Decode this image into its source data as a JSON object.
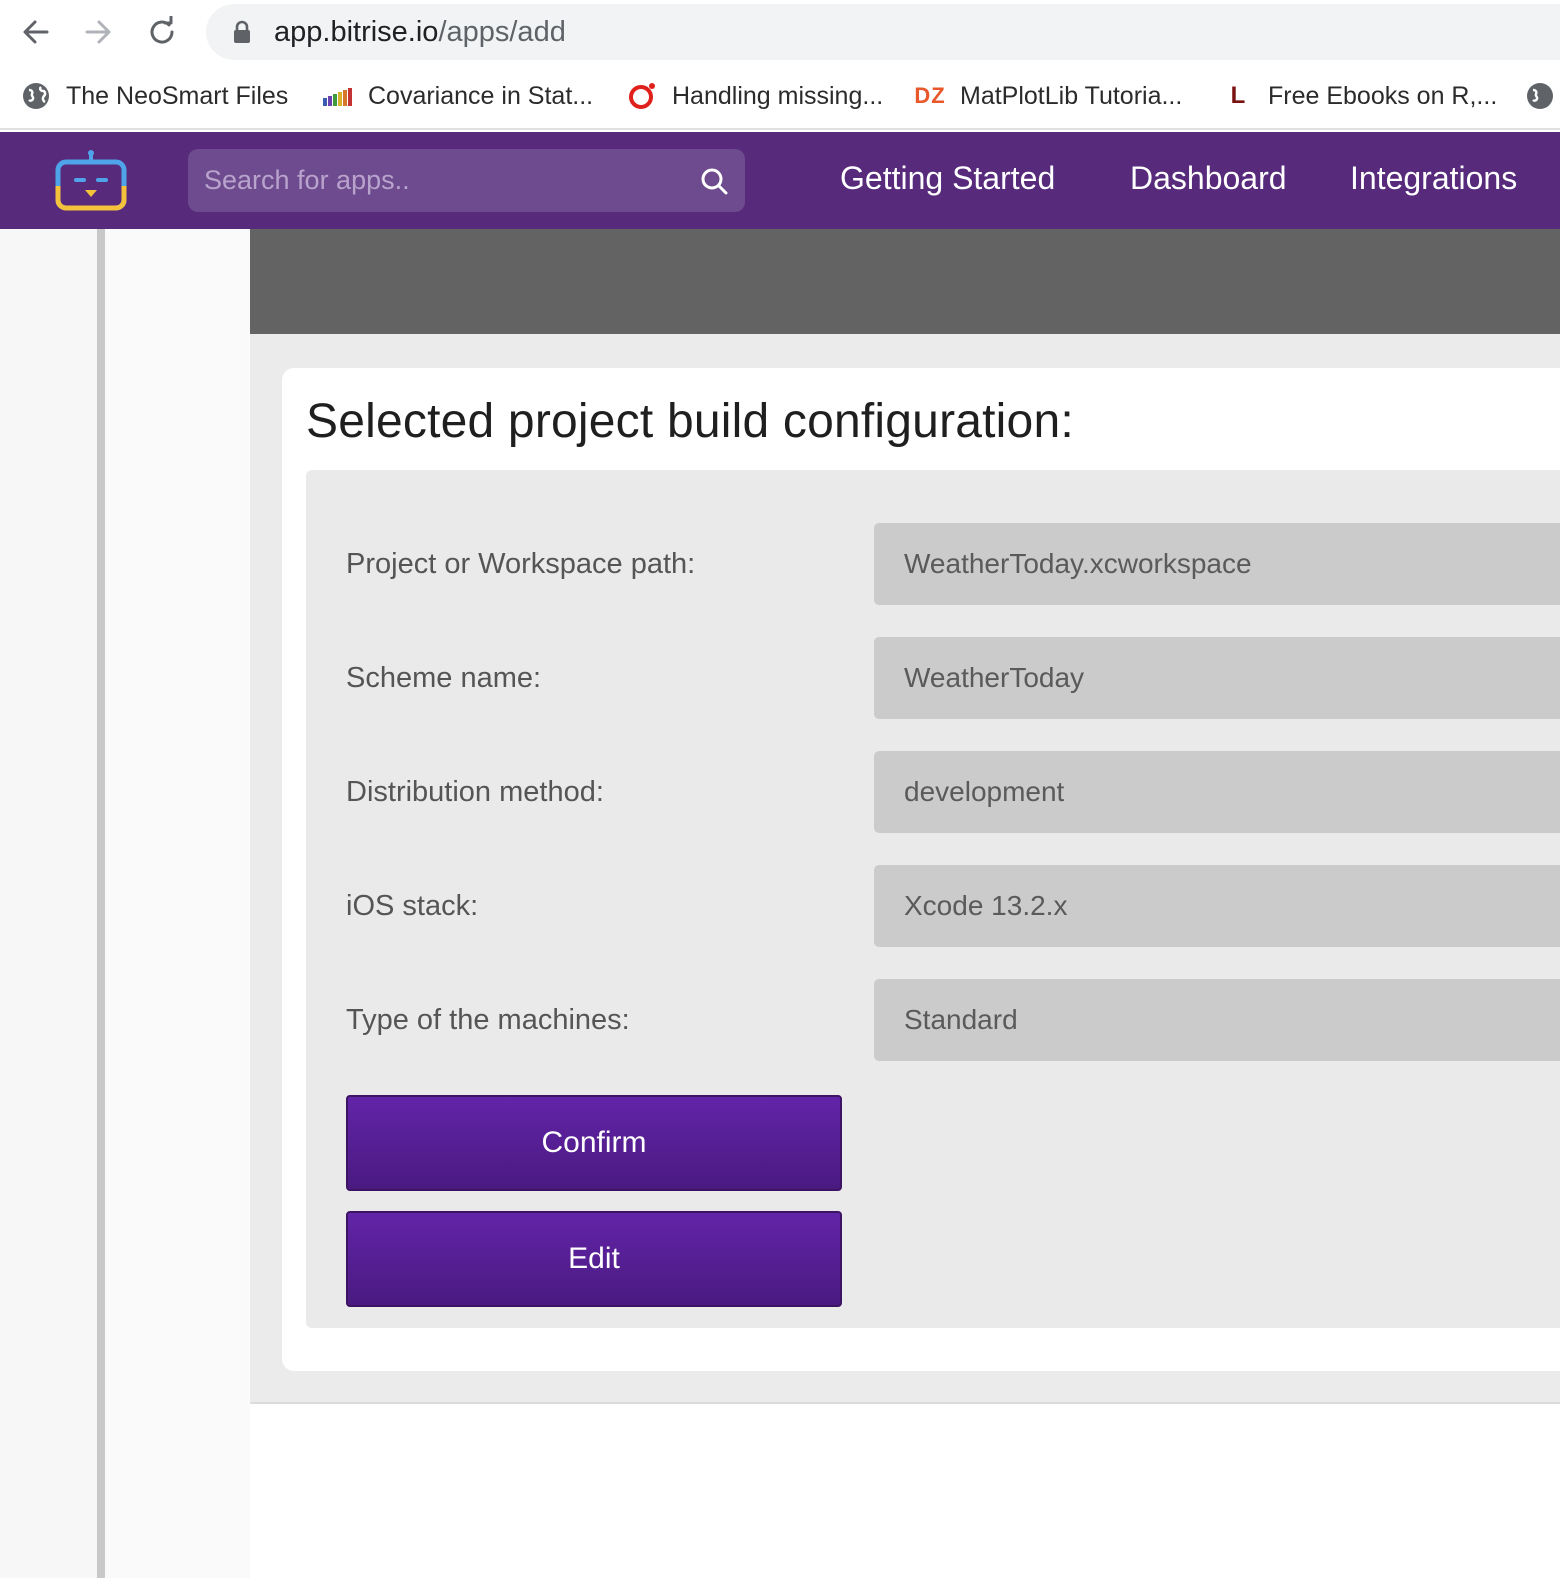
{
  "browser": {
    "url_domain": "app.bitrise.io",
    "url_path": "/apps/add",
    "bookmarks": [
      {
        "label": "The NeoSmart Files",
        "icon": "globe-icon"
      },
      {
        "label": "Covariance in Stat...",
        "icon": "bar-chart-favicon-icon"
      },
      {
        "label": "Handling missing...",
        "icon": "red-ring-favicon-icon"
      },
      {
        "label": "MatPlotLib Tutoria...",
        "icon": "dz-favicon-icon",
        "icon_text": "DZ"
      },
      {
        "label": "Free Ebooks on R,...",
        "icon": "l-favicon-icon",
        "icon_text": "L"
      }
    ]
  },
  "header": {
    "search_placeholder": "Search for apps..",
    "nav": [
      "Getting Started",
      "Dashboard",
      "Integrations"
    ],
    "brand_color": "#572a7c"
  },
  "main": {
    "title": "Selected project build configuration:",
    "fields": [
      {
        "label": "Project or Workspace path:",
        "value": "WeatherToday.xcworkspace"
      },
      {
        "label": "Scheme name:",
        "value": "WeatherToday"
      },
      {
        "label": "Distribution method:",
        "value": "development"
      },
      {
        "label": "iOS stack:",
        "value": "Xcode 13.2.x"
      },
      {
        "label": "Type of the machines:",
        "value": "Standard"
      }
    ],
    "confirm_label": "Confirm",
    "edit_label": "Edit",
    "button_color": "#5a21a0"
  }
}
